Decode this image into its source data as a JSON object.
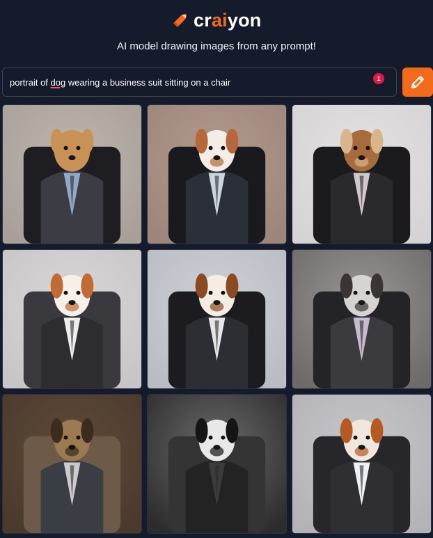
{
  "app": {
    "logo_part1": "cr",
    "logo_part2": "ai",
    "logo_part3": "yon",
    "tagline": "AI model drawing images from any prompt!"
  },
  "prompt": {
    "text_before": "portrait of ",
    "text_flagged": "dog",
    "text_after": " wearing a business suit sitting on a chair",
    "issue_count": "1"
  },
  "colors": {
    "background": "#151b2b",
    "accent": "#f26b1d",
    "badge": "#e0194b"
  },
  "icons": {
    "logo": "pencil-icon",
    "draw_button": "pencil-icon"
  },
  "results": [
    {
      "bg": "#bdb6ad",
      "dog": "#c89256",
      "dog2": "#c89256",
      "suit": "#3c3c44",
      "chair": "#1e1e22",
      "shirt": "#93a9c9",
      "floor": "#a8a098"
    },
    {
      "bg": "#b39a8e",
      "dog": "#f2ede6",
      "dog2": "#b5683a",
      "suit": "#2b2f38",
      "chair": "#1a1a1e",
      "shirt": "#ccd4e0",
      "floor": "#9c857a"
    },
    {
      "bg": "#e3e1e2",
      "dog": "#a86b3d",
      "dog2": "#d9b58c",
      "suit": "#2a2a2e",
      "chair": "#1b1b1d",
      "shirt": "#d2c8cc",
      "floor": "#d6d3d4"
    },
    {
      "bg": "#d9d7d8",
      "dog": "#f5f0ea",
      "dog2": "#c16a35",
      "suit": "#2d2d31",
      "chair": "#3a3a3e",
      "shirt": "#eeeeee",
      "floor": "#c8c5c6"
    },
    {
      "bg": "#cdd0d6",
      "dog": "#f3ede4",
      "dog2": "#8a4a22",
      "suit": "#2c2e34",
      "chair": "#1c1c20",
      "shirt": "#e6e6e6",
      "floor": "#b9bcc2"
    },
    {
      "bg": "#9a9696",
      "dog": "#d7d3d2",
      "dog2": "#3a3434",
      "suit": "#3b3b3d",
      "chair": "#242426",
      "shirt": "#c8bad0",
      "floor": "#6e6a6a"
    },
    {
      "bg": "#5f4a3a",
      "dog": "#9c7a52",
      "dog2": "#3c2c20",
      "suit": "#3a3d44",
      "chair": "#6d5a48",
      "shirt": "#cccccc",
      "floor": "#4a3a2c"
    },
    {
      "bg": "#6b6b6b",
      "dog": "#e8e8e8",
      "dog2": "#151515",
      "suit": "#232323",
      "chair": "#343434",
      "shirt": "#3c3c3c",
      "floor": "#2c2c2c"
    },
    {
      "bg": "#c7c6c9",
      "dog": "#f0e7de",
      "dog2": "#b55a22",
      "suit": "#2f2f33",
      "chair": "#27272b",
      "shirt": "#eef2f6",
      "floor": "#b3b2b6"
    }
  ]
}
